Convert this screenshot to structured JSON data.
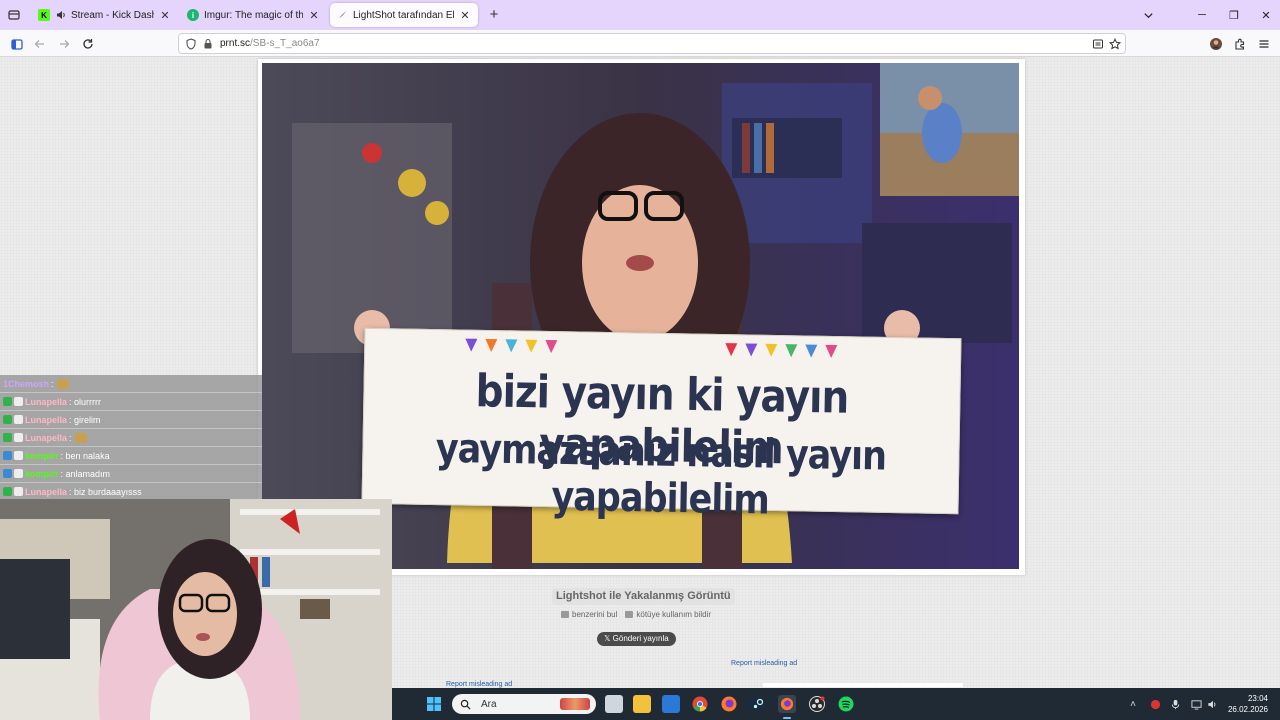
{
  "browser": {
    "tabs": [
      {
        "title": "Stream - Kick Dashboard",
        "favicon": "kick-logo",
        "audio": true,
        "active": false
      },
      {
        "title": "Imgur: The magic of the Interne",
        "favicon": "imgur-logo",
        "audio": false,
        "active": false
      },
      {
        "title": "LightShot tarafından Ekran Görü",
        "favicon": "lightshot-feather",
        "audio": false,
        "active": true
      }
    ],
    "url_host": "prnt.sc",
    "url_path": "/SB-s_T_ao6a7"
  },
  "page": {
    "banner_line1": "bizi yayın ki yayın yapabilelim",
    "banner_line2": "yaymazsanız nasıl yayın yapabilelim",
    "caption": "Lightshot ile Yakalanmış Görüntü",
    "link_similar": "benzerini bul",
    "link_report": "kötüye kullanım bildir",
    "tweet_button": "Gönderi yayınla",
    "report_ad_1": "Report misleading ad",
    "report_ad_2": "Report misleading ad"
  },
  "chat": {
    "messages": [
      {
        "user": "1Chemosh",
        "text": "",
        "emote": true,
        "user_color": "#c9a7ff",
        "badges": 0
      },
      {
        "user": "Lunapella",
        "text": "olurrrrr",
        "emote": false,
        "user_color": "#ffb7c5",
        "badges": 2
      },
      {
        "user": "Lunapella",
        "text": "girelim",
        "emote": false,
        "user_color": "#ffb7c5",
        "badges": 2
      },
      {
        "user": "Lunapella",
        "text": "",
        "emote": true,
        "user_color": "#ffb7c5",
        "badges": 2
      },
      {
        "user": "kompirr",
        "text": "ben nalaka",
        "emote": false,
        "user_color": "#53fc18",
        "badges": 2
      },
      {
        "user": "kompirr",
        "text": "anlamadım",
        "emote": false,
        "user_color": "#53fc18",
        "badges": 2
      },
      {
        "user": "Lunapella",
        "text": "biz burdaaayısss",
        "emote": false,
        "user_color": "#ffb7c5",
        "badges": 2
      }
    ]
  },
  "taskbar": {
    "search_placeholder": "Ara",
    "time": "23:04",
    "date": "26.02.2026",
    "apps": [
      "start-icon",
      "task-view-icon",
      "file-explorer-icon",
      "store-icon",
      "chrome-icon",
      "firefox-icon",
      "steam-icon",
      "firefox-active-icon",
      "obs-icon",
      "spotify-icon"
    ]
  },
  "colors": {
    "tabstrip": "#e5d4fb",
    "accent_kick": "#53fc18",
    "taskbar": "#1f2a34"
  }
}
